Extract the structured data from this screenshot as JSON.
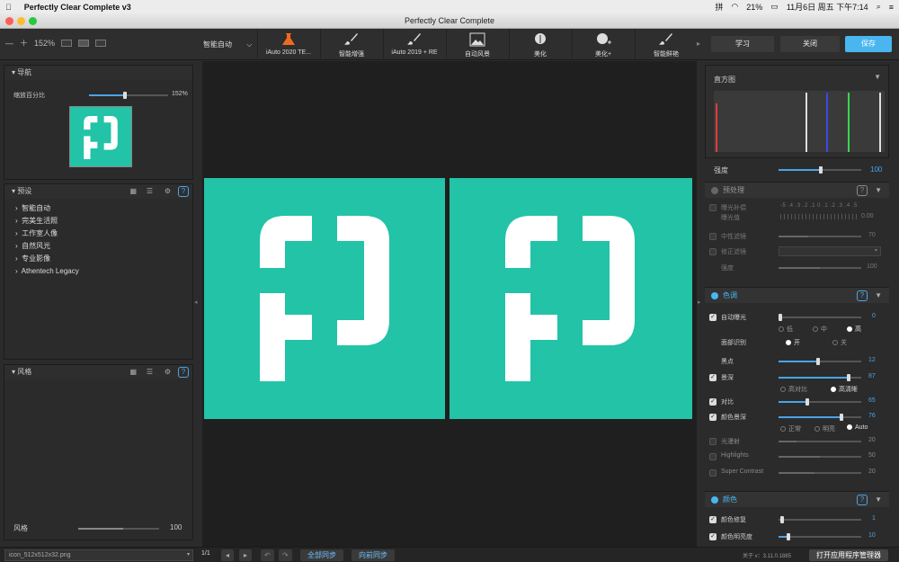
{
  "menubar": {
    "app_name": "Perfectly Clear Complete v3",
    "datetime": "11月6日 周五 下午7:14",
    "battery": "21%",
    "input_method": "拼"
  },
  "window": {
    "title": "Perfectly Clear Complete"
  },
  "toolbar": {
    "zoom": "152%",
    "preset_dropdown": "智能自动",
    "buttons": [
      {
        "label": "iAuto 2020 TE...",
        "icon": "flask-icon"
      },
      {
        "label": "智能增强",
        "icon": "brush-2019-icon"
      },
      {
        "label": "iAuto 2019 + RE",
        "icon": "brush-2019-plus-icon"
      },
      {
        "label": "自动风景",
        "icon": "landscape-icon"
      },
      {
        "label": "美化",
        "icon": "face-icon"
      },
      {
        "label": "美化+",
        "icon": "face-plus-icon"
      },
      {
        "label": "智能鲜艳",
        "icon": "brush-vivid-icon"
      }
    ],
    "learn": "学习",
    "close": "关闭",
    "save": "保存"
  },
  "nav": {
    "title": "导航",
    "zoom_label": "缩放百分比",
    "zoom_value": "152%",
    "zoom_level": 0.45
  },
  "presets": {
    "title": "预设",
    "items": [
      "智能自动",
      "完美生活照",
      "工作室人像",
      "自然风光",
      "专业影像",
      "Athentech Legacy"
    ]
  },
  "style": {
    "title": "风格",
    "slider_label": "风格",
    "slider_value": "100",
    "level": 0.55
  },
  "histogram": {
    "title": "直方图"
  },
  "right": {
    "strength_label": "强度",
    "strength_value": "100",
    "pre": {
      "title": "预处理",
      "exposure_comp": "曝光补偿",
      "exposure_value": "0.00",
      "scale": "-5 .4 .3 .2 .1 0 .1 .2 .3 .4 .5",
      "exposure_sub": "曝光值",
      "neutral": "中性滤镜",
      "neutral_value": "70",
      "correction": "修正滤镜",
      "strength2": "强度",
      "strength2_value": "100"
    },
    "tone": {
      "title": "色调",
      "auto_exposure": "自动曝光",
      "auto_exposure_value": "0",
      "low": "低",
      "mid": "中",
      "high": "高",
      "face": "面部识别",
      "on": "开",
      "off": "关",
      "black": "黑点",
      "black_value": "12",
      "depth": "景深",
      "depth_value": "87",
      "high_contrast": "高对比",
      "high_def": "高清晰",
      "contrast": "对比",
      "contrast_value": "65",
      "vibrance": "颜色景深",
      "vibrance_value": "76",
      "normal": "正常",
      "bright": "明亮",
      "auto": "Auto",
      "light_diff": "光漫射",
      "light_diff_value": "20",
      "highlights": "Highlights",
      "highlights_value": "50",
      "super_contrast": "Super Contrast",
      "super_contrast_value": "20"
    },
    "color": {
      "title": "颜色",
      "restore": "颜色修复",
      "restore_value": "1",
      "brightness": "颜色明亮度",
      "brightness_value": "10"
    }
  },
  "status": {
    "filename": "icon_512x512x32.png",
    "page": "1/1",
    "sync_all": "全部同步",
    "sync_forward": "向前同步",
    "version": "关于 v：3.11.0.1885",
    "open_manager": "打开应用程序管理器"
  }
}
